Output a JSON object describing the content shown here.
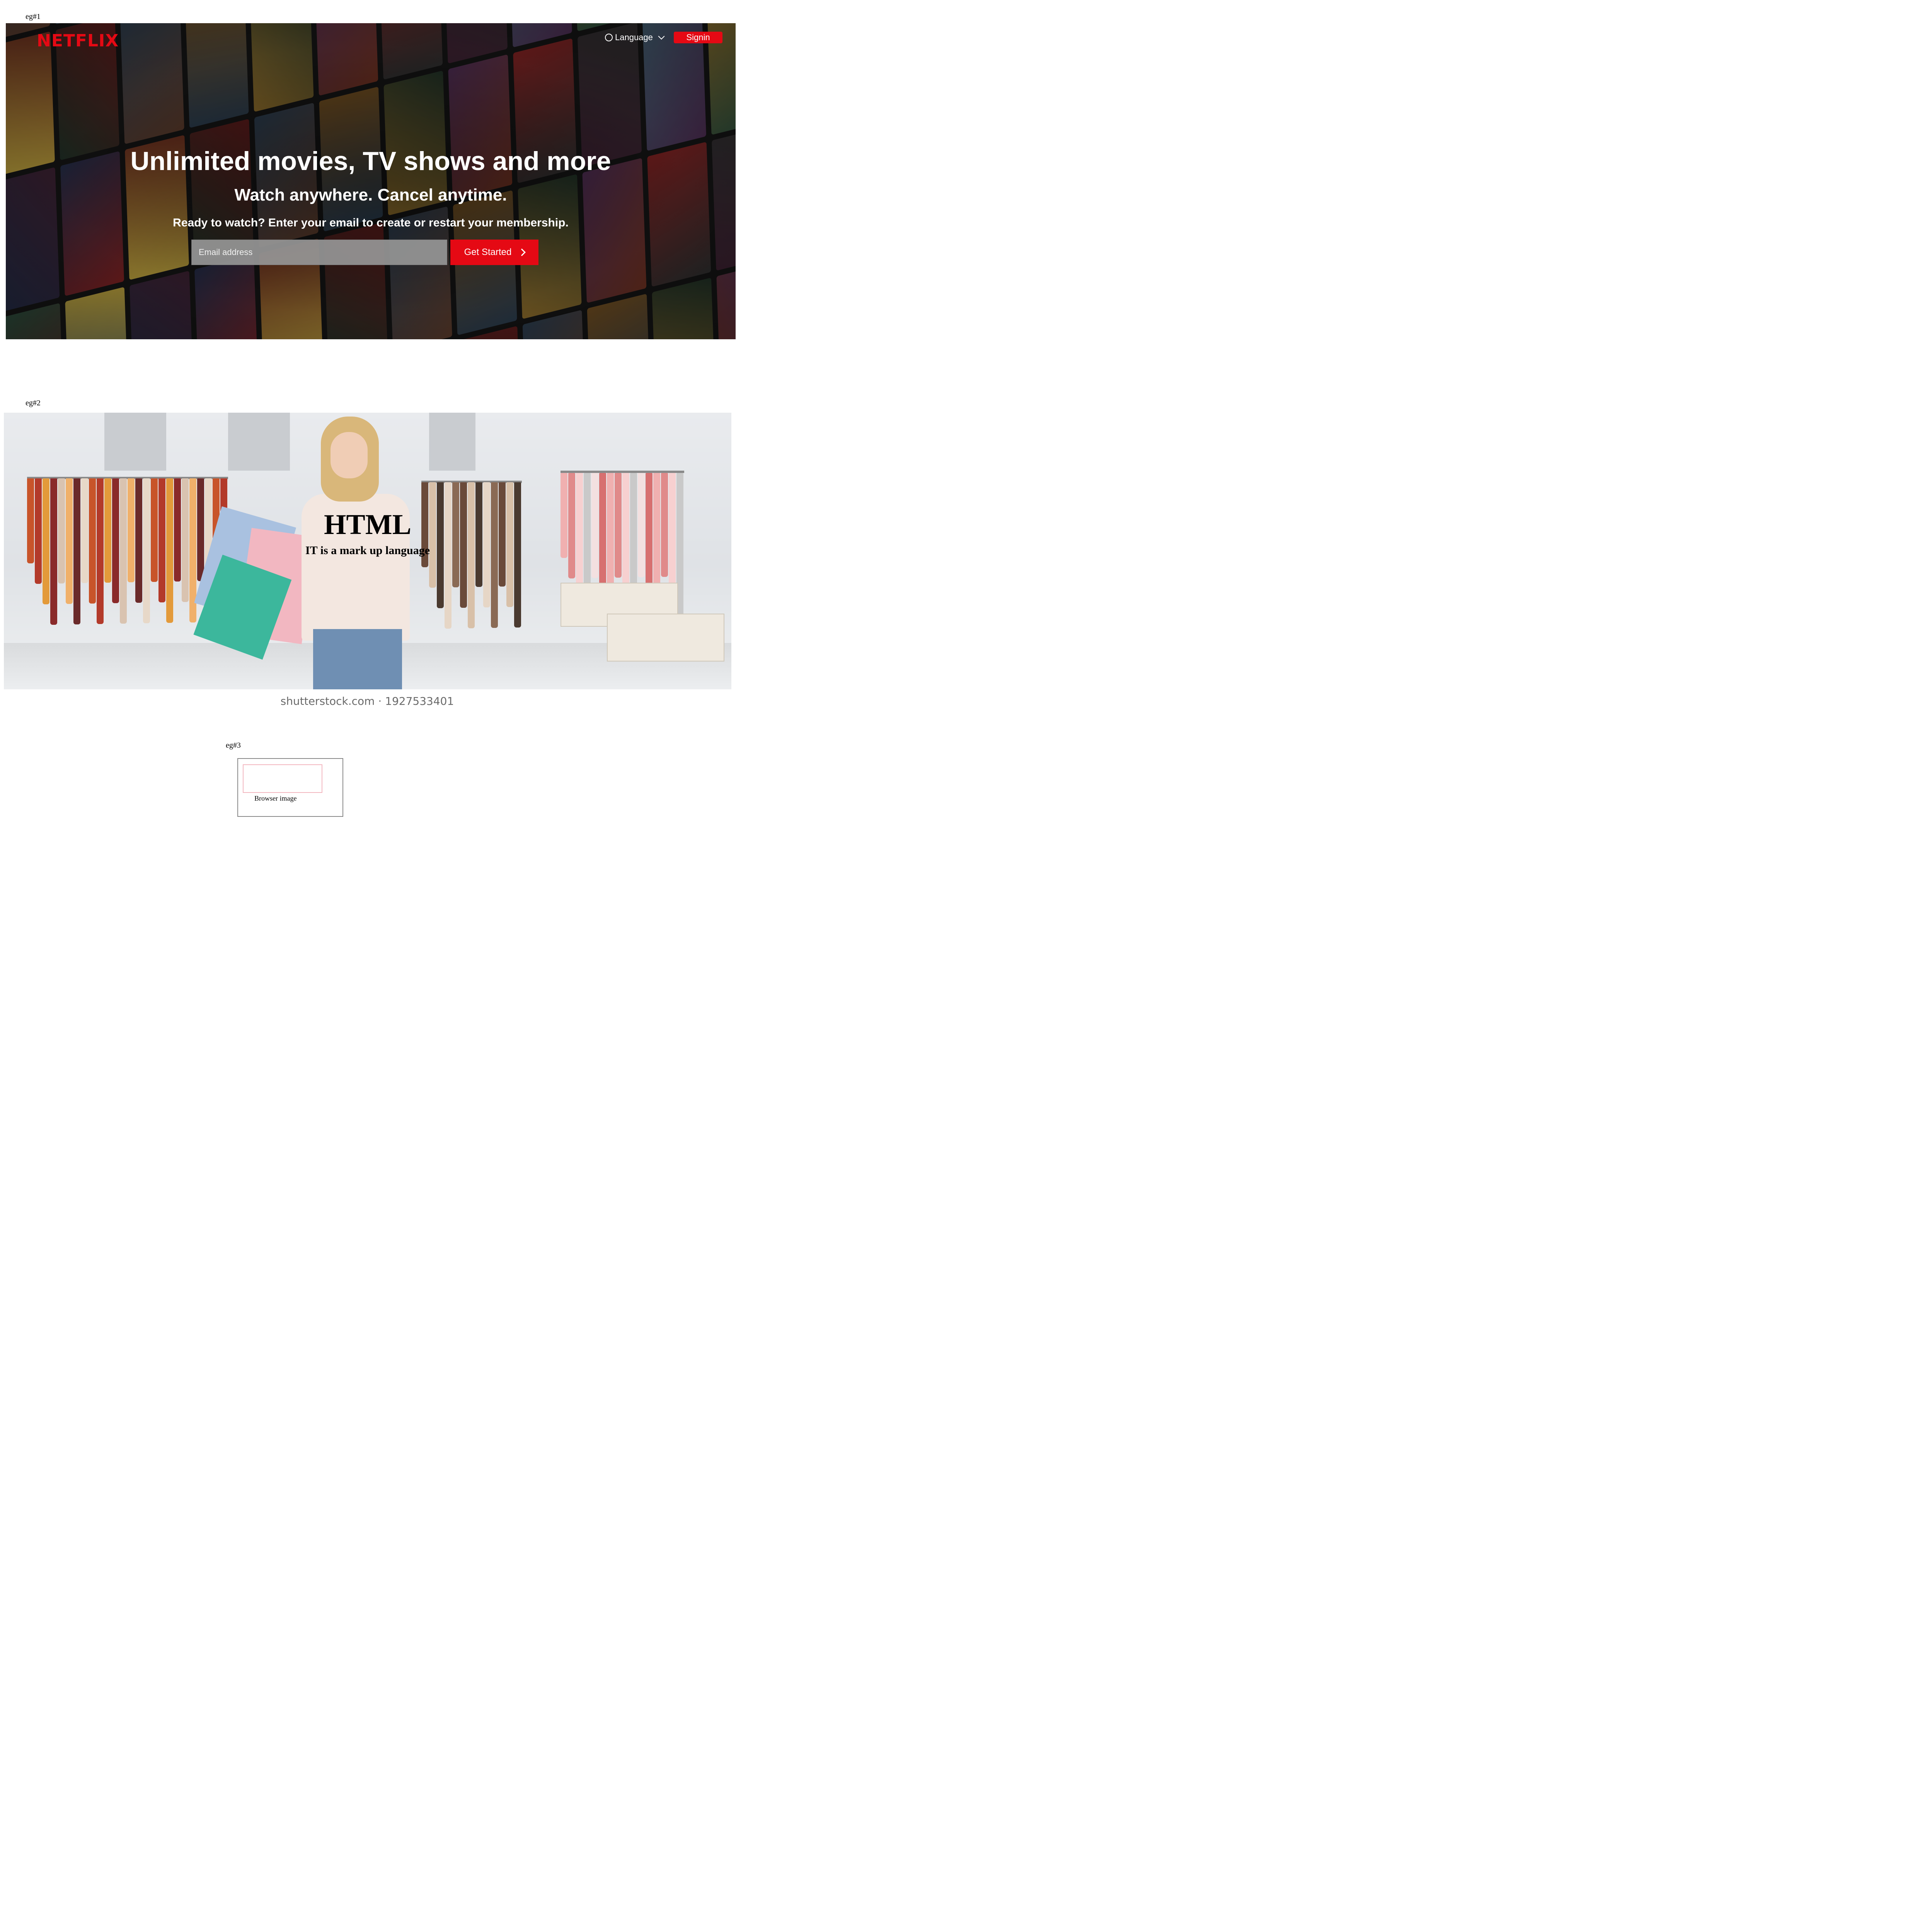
{
  "examples": {
    "eg1": "eg#1",
    "eg2": "eg#2",
    "eg3": "eg#3"
  },
  "netflix": {
    "logo": "NETFLIX",
    "language_label": "Language",
    "signin_label": "Signin",
    "title": "Unlimited movies, TV shows and more",
    "subtitle": "Watch anywhere. Cancel anytime.",
    "cta_text": "Ready to watch? Enter your email to create or restart your membership.",
    "email_placeholder": "Email address",
    "email_value": "",
    "get_started_label": "Get Started",
    "icons": {
      "language": "globe-icon",
      "language_toggle": "chevron-down-icon",
      "get_started": "chevron-right-icon"
    },
    "colors": {
      "brand": "#e50914",
      "text": "#ffffff"
    }
  },
  "store": {
    "title": "HTML",
    "subtitle": "IT is a mark up language",
    "watermark": "shutterstock.com · 1927533401"
  },
  "figure": {
    "caption": "Browser image"
  }
}
